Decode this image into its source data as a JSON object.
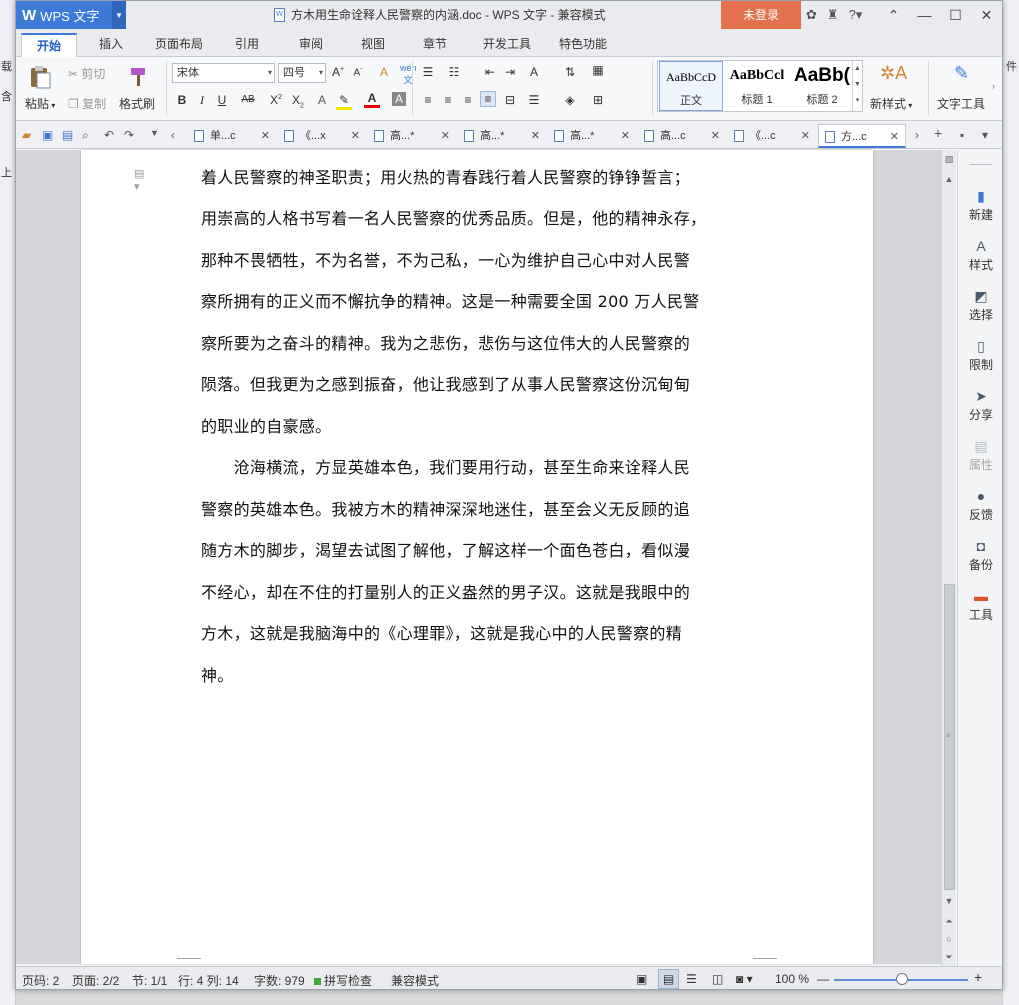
{
  "background": {
    "left_strip_texts": [
      "载",
      "含",
      "上"
    ],
    "right_strip_text": "件"
  },
  "titlebar": {
    "app_name": "WPS 文字",
    "doc_title": "方木用生命诠释人民警察的内涵.doc - WPS 文字 - 兼容模式",
    "login_label": "未登录",
    "help_label": "?"
  },
  "ribbon_tabs": [
    "开始",
    "插入",
    "页面布局",
    "引用",
    "审阅",
    "视图",
    "章节",
    "开发工具",
    "特色功能"
  ],
  "ribbon": {
    "paste": "粘贴",
    "cut": "剪切",
    "copy": "复制",
    "format_painter": "格式刷",
    "font_name": "宋体",
    "font_size": "四号",
    "styles": [
      {
        "sample": "AaBbCcD",
        "label": "正文"
      },
      {
        "sample": "AaBbCcl",
        "label": "标题 1"
      },
      {
        "sample": "AaBb(",
        "label": "标题 2"
      }
    ],
    "new_style": "新样式",
    "text_tools": "文字工具"
  },
  "doc_tabs": [
    {
      "label": "单...c",
      "active": false
    },
    {
      "label": "《...x",
      "active": false
    },
    {
      "label": "高...*",
      "active": false
    },
    {
      "label": "高...*",
      "active": false
    },
    {
      "label": "高...*",
      "active": false
    },
    {
      "label": "高...c",
      "active": false
    },
    {
      "label": "《...c",
      "active": false
    },
    {
      "label": "方...c",
      "active": true
    }
  ],
  "document": {
    "lines": [
      "着人民警察的神圣职责；用火热的青春践行着人民警察的铮铮誓言；",
      "用崇高的人格书写着一名人民警察的优秀品质。但是，他的精神永存，",
      "那种不畏牺牲，不为名誉，不为己私，一心为维护自己心中对人民警",
      "察所拥有的正义而不懈抗争的精神。这是一种需要全国 200 万人民警",
      "察所要为之奋斗的精神。我为之悲伤，悲伤与这位伟大的人民警察的",
      "陨落。但我更为之感到振奋，他让我感到了从事人民警察这份沉甸甸",
      "的职业的自豪感。",
      "　　沧海横流，方显英雄本色，我们要用行动，甚至生命来诠释人民",
      "警察的英雄本色。我被方木的精神深深地迷住，甚至会义无反顾的追",
      "随方木的脚步，渴望去试图了解他，了解这样一个面色苍白，看似漫",
      "不经心，却在不住的打量别人的正义盎然的男子汉。这就是我眼中的",
      "方木，这就是我脑海中的《心理罪》，这就是我心中的人民警察的精",
      "神。"
    ]
  },
  "taskpane": [
    {
      "label": "新建",
      "icon": "new-doc-icon",
      "disabled": false
    },
    {
      "label": "样式",
      "icon": "style-icon",
      "disabled": false
    },
    {
      "label": "选择",
      "icon": "select-icon",
      "disabled": false
    },
    {
      "label": "限制",
      "icon": "restrict-icon",
      "disabled": false
    },
    {
      "label": "分享",
      "icon": "share-icon",
      "disabled": false
    },
    {
      "label": "属性",
      "icon": "properties-icon",
      "disabled": true
    },
    {
      "label": "反馈",
      "icon": "feedback-icon",
      "disabled": false
    },
    {
      "label": "备份",
      "icon": "backup-icon",
      "disabled": false
    },
    {
      "label": "工具",
      "icon": "toolbox-icon",
      "disabled": false
    }
  ],
  "statusbar": {
    "page_num": "页码: 2",
    "pages": "页面: 2/2",
    "section": "节: 1/1",
    "row_col": "行: 4  列: 14",
    "word_count": "字数: 979",
    "spell_check": "拼写检查",
    "compat_mode": "兼容模式",
    "zoom": "100 %",
    "zoom_level_percent": 100
  },
  "colors": {
    "accent": "#3d7ad8",
    "login_bg": "#e5704e",
    "spell_ok": "#3aa935"
  }
}
